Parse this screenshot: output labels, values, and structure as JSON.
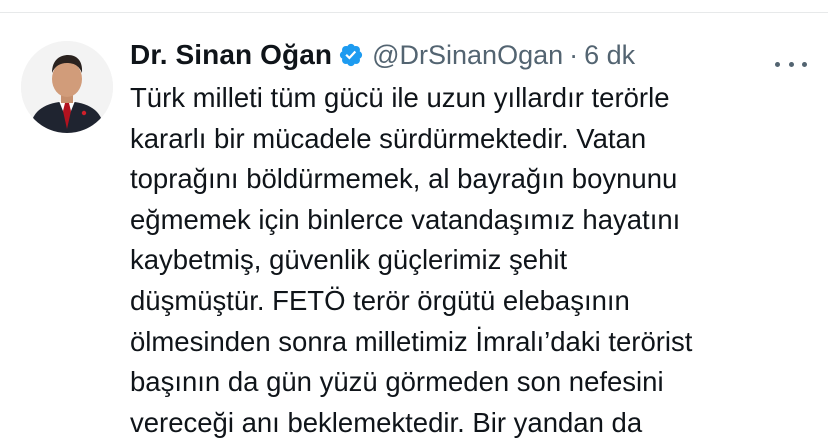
{
  "tweet": {
    "author": {
      "display_name": "Dr. Sinan Oğan",
      "handle": "@DrSinanOgan",
      "verified_icon": "verified-badge-icon",
      "avatar_alt": "Dr. Sinan Oğan profile photo"
    },
    "separator": "·",
    "timestamp": "6 dk",
    "more_icon": "more-horizontal-icon",
    "text_lines": [
      "Türk milleti tüm gücü ile uzun yıllardır terörle",
      "kararlı bir mücadele sürdürmektedir. Vatan",
      "toprağını böldürmemek, al bayrağın boynunu",
      "eğmemek için binlerce vatandaşımız hayatını",
      "kaybetmiş, güvenlik güçlerimiz şehit",
      "düşmüştür. FETÖ terör örgütü elebaşının",
      "ölmesinden sonra milletimiz İmralı’daki terörist",
      "başının da gün yüzü görmeden son nefesini",
      "vereceği anı beklemektedir. Bir yandan da"
    ]
  },
  "colors": {
    "text_primary": "#0f1419",
    "text_secondary": "#536471",
    "verified_blue": "#1d9bf0",
    "divider": "#e7e9ea"
  }
}
